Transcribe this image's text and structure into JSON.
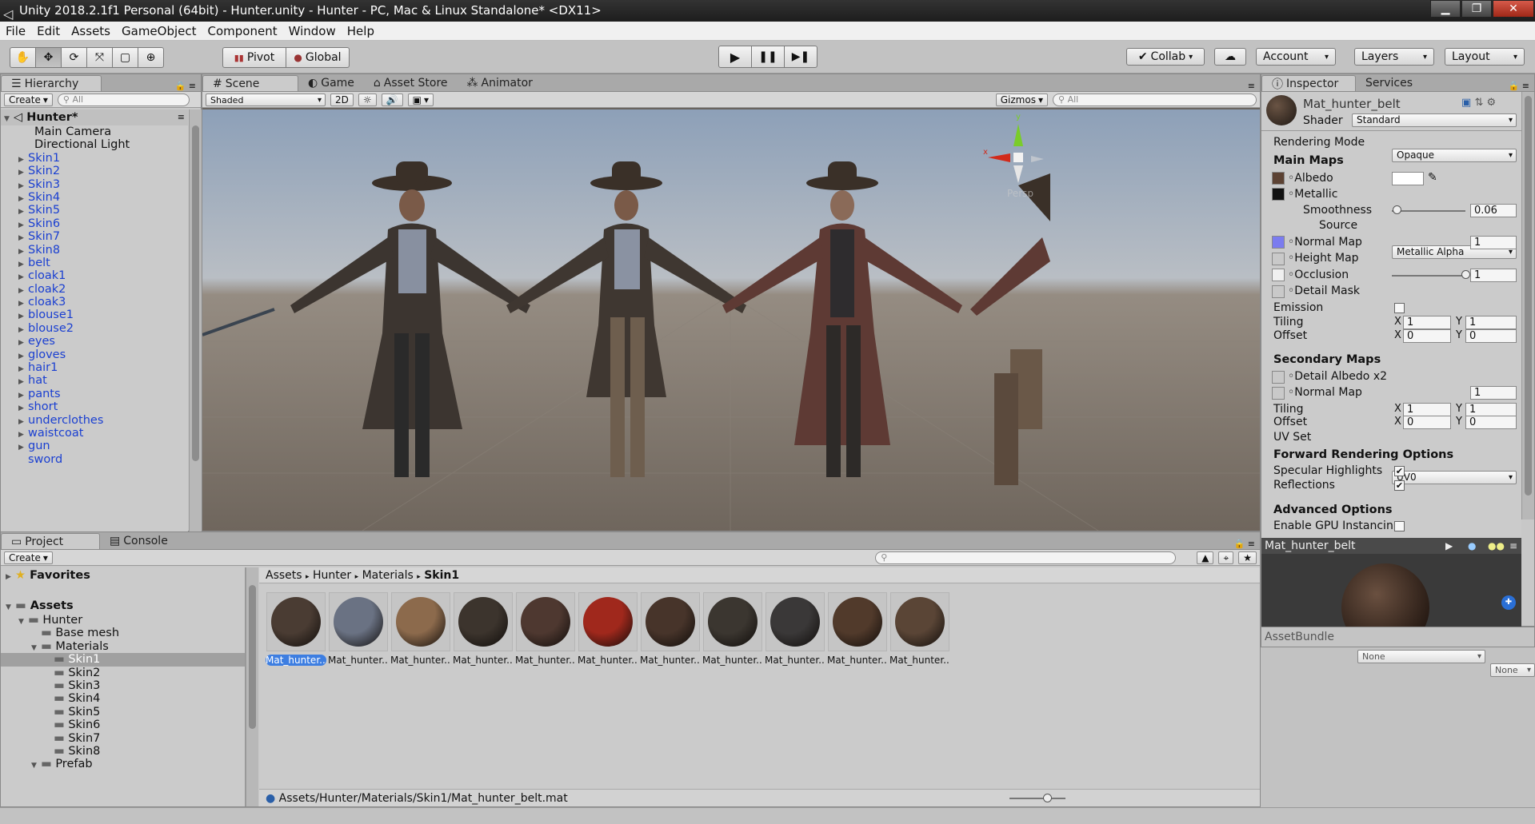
{
  "window": {
    "title": "Unity 2018.2.1f1 Personal (64bit) - Hunter.unity - Hunter - PC, Mac & Linux Standalone* <DX11>",
    "minimize": "▁",
    "maximize": "❐",
    "close": "✕"
  },
  "menu": [
    "File",
    "Edit",
    "Assets",
    "GameObject",
    "Component",
    "Window",
    "Help"
  ],
  "toolbar": {
    "pivot": "Pivot",
    "global": "Global",
    "collab": "Collab",
    "account": "Account",
    "layers": "Layers",
    "layout": "Layout"
  },
  "hierarchy": {
    "tab": "Hierarchy",
    "create": "Create",
    "search_placeholder": "All",
    "scene": "Hunter*",
    "items": [
      {
        "label": "Main Camera",
        "expandable": false,
        "prefab": false
      },
      {
        "label": "Directional Light",
        "expandable": false,
        "prefab": false
      },
      {
        "label": "Skin1",
        "expandable": true,
        "prefab": true
      },
      {
        "label": "Skin2",
        "expandable": true,
        "prefab": true
      },
      {
        "label": "Skin3",
        "expandable": true,
        "prefab": true
      },
      {
        "label": "Skin4",
        "expandable": true,
        "prefab": true
      },
      {
        "label": "Skin5",
        "expandable": true,
        "prefab": true
      },
      {
        "label": "Skin6",
        "expandable": true,
        "prefab": true
      },
      {
        "label": "Skin7",
        "expandable": true,
        "prefab": true
      },
      {
        "label": "Skin8",
        "expandable": true,
        "prefab": true
      },
      {
        "label": "belt",
        "expandable": true,
        "prefab": true
      },
      {
        "label": "cloak1",
        "expandable": true,
        "prefab": true
      },
      {
        "label": "cloak2",
        "expandable": true,
        "prefab": true
      },
      {
        "label": "cloak3",
        "expandable": true,
        "prefab": true
      },
      {
        "label": "blouse1",
        "expandable": true,
        "prefab": true
      },
      {
        "label": "blouse2",
        "expandable": true,
        "prefab": true
      },
      {
        "label": "eyes",
        "expandable": true,
        "prefab": true
      },
      {
        "label": "gloves",
        "expandable": true,
        "prefab": true
      },
      {
        "label": "hair1",
        "expandable": true,
        "prefab": true
      },
      {
        "label": "hat",
        "expandable": true,
        "prefab": true
      },
      {
        "label": "pants",
        "expandable": true,
        "prefab": true
      },
      {
        "label": "short",
        "expandable": true,
        "prefab": true
      },
      {
        "label": "underclothes",
        "expandable": true,
        "prefab": true
      },
      {
        "label": "waistcoat",
        "expandable": true,
        "prefab": true
      },
      {
        "label": "gun",
        "expandable": true,
        "prefab": true
      },
      {
        "label": "sword",
        "expandable": false,
        "prefab": true
      }
    ]
  },
  "scene_tabs": {
    "scene": "Scene",
    "game": "Game",
    "asset_store": "Asset Store",
    "animator": "Animator"
  },
  "scene_bar": {
    "shading": "Shaded",
    "mode_2d": "2D",
    "gizmos": "Gizmos",
    "search_placeholder": "All"
  },
  "gizmo": {
    "persp": "Persp",
    "x": "x",
    "y": "y"
  },
  "project": {
    "tab": "Project",
    "console_tab": "Console",
    "create": "Create",
    "favorites": "Favorites",
    "assets": "Assets",
    "tree": [
      {
        "label": "Hunter",
        "depth": 1,
        "open": true
      },
      {
        "label": "Base mesh",
        "depth": 2,
        "open": false
      },
      {
        "label": "Materials",
        "depth": 2,
        "open": true
      },
      {
        "label": "Skin1",
        "depth": 3,
        "open": false,
        "selected": true
      },
      {
        "label": "Skin2",
        "depth": 3,
        "open": false
      },
      {
        "label": "Skin3",
        "depth": 3,
        "open": false
      },
      {
        "label": "Skin4",
        "depth": 3,
        "open": false
      },
      {
        "label": "Skin5",
        "depth": 3,
        "open": false
      },
      {
        "label": "Skin6",
        "depth": 3,
        "open": false
      },
      {
        "label": "Skin7",
        "depth": 3,
        "open": false
      },
      {
        "label": "Skin8",
        "depth": 3,
        "open": false
      },
      {
        "label": "Prefab",
        "depth": 2,
        "open": true
      }
    ],
    "breadcrumb": [
      "Assets",
      "Hunter",
      "Materials",
      "Skin1"
    ],
    "assets_list": [
      {
        "label": "Mat_hunter...",
        "color": "#4a3c33",
        "selected": true
      },
      {
        "label": "Mat_hunter...",
        "color": "#6a7283"
      },
      {
        "label": "Mat_hunter...",
        "color": "#8c6a4c"
      },
      {
        "label": "Mat_hunter...",
        "color": "#3c342d"
      },
      {
        "label": "Mat_hunter...",
        "color": "#4e3830"
      },
      {
        "label": "Mat_hunter...",
        "color": "#a0281c"
      },
      {
        "label": "Mat_hunter...",
        "color": "#47342a"
      },
      {
        "label": "Mat_hunter...",
        "color": "#3b3630"
      },
      {
        "label": "Mat_hunter...",
        "color": "#3a3838"
      },
      {
        "label": "Mat_hunter...",
        "color": "#513a2b"
      },
      {
        "label": "Mat_hunter...",
        "color": "#5a4536"
      }
    ],
    "status_path": "Assets/Hunter/Materials/Skin1/Mat_hunter_belt.mat"
  },
  "inspector": {
    "tab": "Inspector",
    "services_tab": "Services",
    "material_name": "Mat_hunter_belt",
    "shader_label": "Shader",
    "shader_value": "Standard",
    "rendering_mode_label": "Rendering Mode",
    "rendering_mode_value": "Opaque",
    "main_maps": "Main Maps",
    "albedo": "Albedo",
    "metallic": "Metallic",
    "smoothness_label": "Smoothness",
    "smoothness_value": "0.06",
    "smoothness": 0.06,
    "source_label": "Source",
    "source_value": "Metallic Alpha",
    "normal_map": "Normal Map",
    "normal_value": "1",
    "height_map": "Height Map",
    "occlusion": "Occlusion",
    "occlusion_value": "1",
    "occlusion_level": 1.0,
    "detail_mask": "Detail Mask",
    "emission": "Emission",
    "tiling": "Tiling",
    "offset": "Offset",
    "x": "X",
    "y": "Y",
    "tiling_x": "1",
    "tiling_y": "1",
    "offset_x": "0",
    "offset_y": "0",
    "secondary_maps": "Secondary Maps",
    "detail_albedo": "Detail Albedo x2",
    "normal_map2": "Normal Map",
    "normal2_value": "1",
    "tiling2_x": "1",
    "tiling2_y": "1",
    "offset2_x": "0",
    "offset2_y": "0",
    "uv_set_label": "UV Set",
    "uv_set_value": "UV0",
    "forward_rendering": "Forward Rendering Options",
    "specular": "Specular Highlights",
    "reflections": "Reflections",
    "advanced": "Advanced Options",
    "gpu_instancing": "Enable GPU Instancing",
    "preview_title": "Mat_hunter_belt",
    "assetbundle_label": "AssetBundle",
    "assetbundle_value": "None",
    "variant_value": "None"
  }
}
